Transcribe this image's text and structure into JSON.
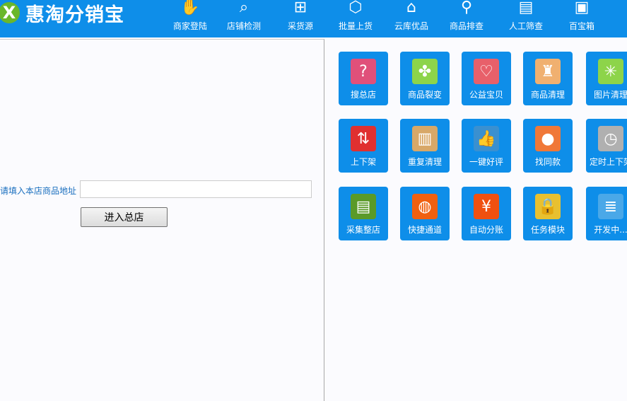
{
  "app": {
    "title": "惠淘分销宝"
  },
  "nav": [
    {
      "label": "商家登陆",
      "icon": "hand-icon"
    },
    {
      "label": "店铺检测",
      "icon": "search-wave-icon"
    },
    {
      "label": "采货源",
      "icon": "cart-add-icon"
    },
    {
      "label": "批量上货",
      "icon": "box-upload-icon"
    },
    {
      "label": "云库优品",
      "icon": "warehouse-icon"
    },
    {
      "label": "商品排查",
      "icon": "inspect-icon"
    },
    {
      "label": "人工筛查",
      "icon": "document-search-icon"
    },
    {
      "label": "百宝箱",
      "icon": "treasure-box-icon"
    }
  ],
  "form": {
    "address_label": "请填入本店商品地址",
    "address_value": "",
    "button_label": "进入总店"
  },
  "tiles": [
    {
      "label": "搜总店",
      "icon": "search-store-icon",
      "color": "#e0507a"
    },
    {
      "label": "商品裂变",
      "icon": "clover-icon",
      "color": "#8dd44a"
    },
    {
      "label": "公益宝贝",
      "icon": "heart-icon",
      "color": "#e8606a"
    },
    {
      "label": "商品清理",
      "icon": "broom-icon",
      "color": "#f0b070"
    },
    {
      "label": "图片清理",
      "icon": "loading-icon",
      "color": "#8dd44a"
    },
    {
      "label": "上下架",
      "icon": "up-down-arrows-icon",
      "color": "#e03030"
    },
    {
      "label": "重复清理",
      "icon": "trash-icon",
      "color": "#d8a868"
    },
    {
      "label": "一键好评",
      "icon": "thumbs-up-icon",
      "color": "#3a90d0"
    },
    {
      "label": "找同款",
      "icon": "person-pin-icon",
      "color": "#f07838"
    },
    {
      "label": "定时上下架",
      "icon": "clock-play-icon",
      "color": "#b0b0b0"
    },
    {
      "label": "采集整店",
      "icon": "floppy-disk-icon",
      "color": "#5a9a28"
    },
    {
      "label": "快捷通道",
      "icon": "globe-icon",
      "color": "#f06010"
    },
    {
      "label": "自动分账",
      "icon": "yen-icon",
      "color": "#f05010"
    },
    {
      "label": "任务模块",
      "icon": "padlock-icon",
      "color": "#e8c030"
    },
    {
      "label": "开发中...",
      "icon": "stack-books-icon",
      "color": "#4aa8e8"
    }
  ]
}
